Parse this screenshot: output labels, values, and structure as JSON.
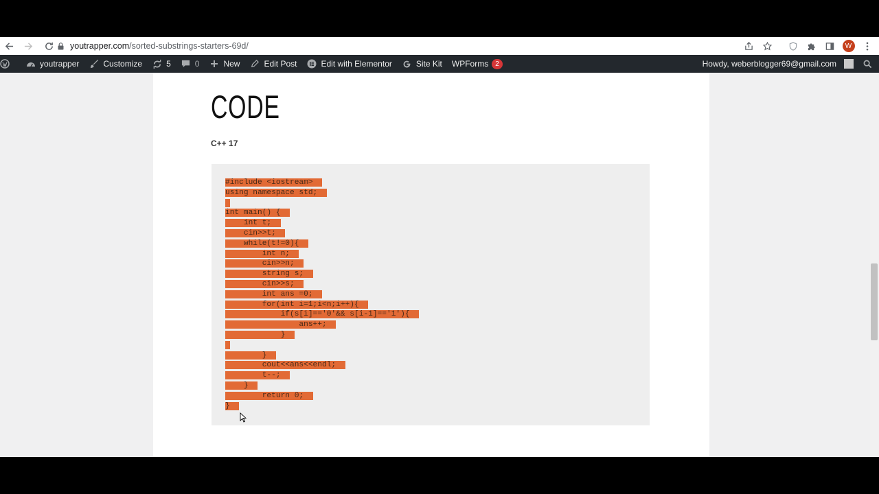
{
  "browser": {
    "url_host": "youtrapper.com",
    "url_path": "/sorted-substrings-starters-69d/",
    "profile_initial": "W"
  },
  "adminbar": {
    "site_name": "youtrapper",
    "customize": "Customize",
    "updates_count": "5",
    "comments_count": "0",
    "new": "New",
    "edit_post": "Edit Post",
    "edit_elementor": "Edit with Elementor",
    "site_kit": "Site Kit",
    "wpforms": "WPForms",
    "wpforms_badge": "2",
    "howdy": "Howdy, weberblogger69@gmail.com"
  },
  "article": {
    "heading": "CODE",
    "language": "C++ 17",
    "code_lines": [
      "#include <iostream>",
      "using namespace std;",
      "",
      "int main() {",
      "    int t;",
      "    cin>>t;",
      "    while(t!=0){",
      "        int n;",
      "        cin>>n;",
      "        string s;",
      "        cin>>s;",
      "        int ans =0;",
      "        for(int i=1;i<n;i++){",
      "            if(s[i]=='0'&& s[i-1]=='1'){",
      "                ans++;",
      "            }",
      "",
      "        }",
      "        cout<<ans<<endl;",
      "        t--;",
      "    }",
      "        return 0;",
      "}"
    ]
  },
  "colors": {
    "selection": "#e26a35",
    "adminbar_bg": "#23282d",
    "codebox_bg": "#eeeeee"
  }
}
